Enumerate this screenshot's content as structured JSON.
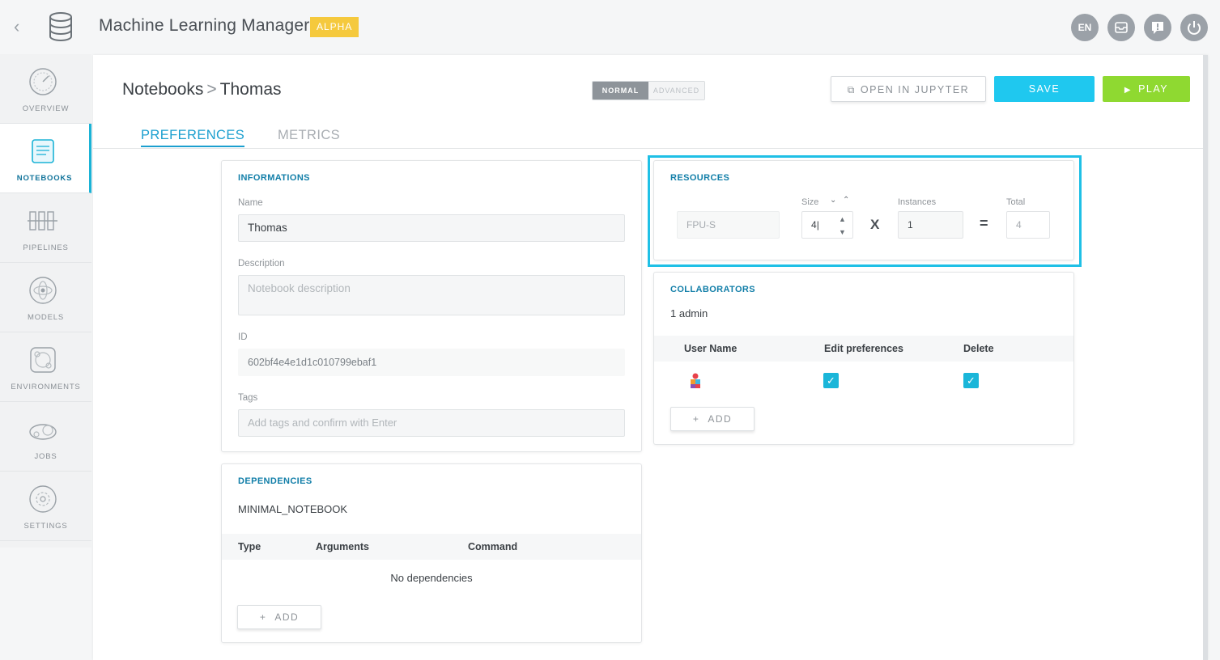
{
  "app": {
    "title": "Machine Learning Manager",
    "badge": "ALPHA",
    "lang": "EN"
  },
  "sidebar": {
    "items": [
      {
        "label": "OVERVIEW",
        "icon": "dashboard-gauge-icon",
        "active": false
      },
      {
        "label": "NOTEBOOKS",
        "icon": "notebook-icon",
        "active": true
      },
      {
        "label": "PIPELINES",
        "icon": "pipeline-icon",
        "active": false
      },
      {
        "label": "MODELS",
        "icon": "atom-model-icon",
        "active": false
      },
      {
        "label": "ENVIRONMENTS",
        "icon": "environment-icon",
        "active": false
      },
      {
        "label": "JOBS",
        "icon": "jobs-gear-icon",
        "active": false
      },
      {
        "label": "SETTINGS",
        "icon": "settings-gear-icon",
        "active": false
      }
    ]
  },
  "header": {
    "breadcrumb_parent": "Notebooks",
    "breadcrumb_separator": ">",
    "breadcrumb_current": "Thomas",
    "mode_normal": "NORMAL",
    "mode_advanced": "ADVANCED",
    "open_jupyter": "OPEN IN JUPYTER",
    "save": "SAVE",
    "play": "PLAY"
  },
  "tabs": [
    {
      "label": "PREFERENCES",
      "active": true
    },
    {
      "label": "METRICS",
      "active": false
    }
  ],
  "informations": {
    "title": "INFORMATIONS",
    "name_label": "Name",
    "name_value": "Thomas",
    "description_label": "Description",
    "description_placeholder": "Notebook description",
    "id_label": "ID",
    "id_value": "602bf4e4e1d1c010799ebaf1",
    "tags_label": "Tags",
    "tags_placeholder": "Add tags and confirm with Enter"
  },
  "dependencies": {
    "title": "DEPENDENCIES",
    "environment": "MINIMAL_NOTEBOOK",
    "columns": [
      "Type",
      "Arguments",
      "Command"
    ],
    "empty_text": "No dependencies",
    "add_label": "ADD"
  },
  "resources": {
    "title": "RESOURCES",
    "unit": "FPU-S",
    "size_label": "Size",
    "size_value": "4",
    "times": "X",
    "instances_label": "Instances",
    "instances_value": "1",
    "equals": "=",
    "total_label": "Total",
    "total_value": "4"
  },
  "collaborators": {
    "title": "COLLABORATORS",
    "summary": "1 admin",
    "columns": [
      "User Name",
      "Edit preferences",
      "Delete"
    ],
    "rows": [
      {
        "avatar": "user-avatar-icon",
        "edit": true,
        "delete": true
      }
    ],
    "add_label": "ADD"
  },
  "colors": {
    "accent": "#1fc8ef",
    "play": "#8fd931",
    "badge": "#f5c93d",
    "title_blue": "#117ea8"
  }
}
